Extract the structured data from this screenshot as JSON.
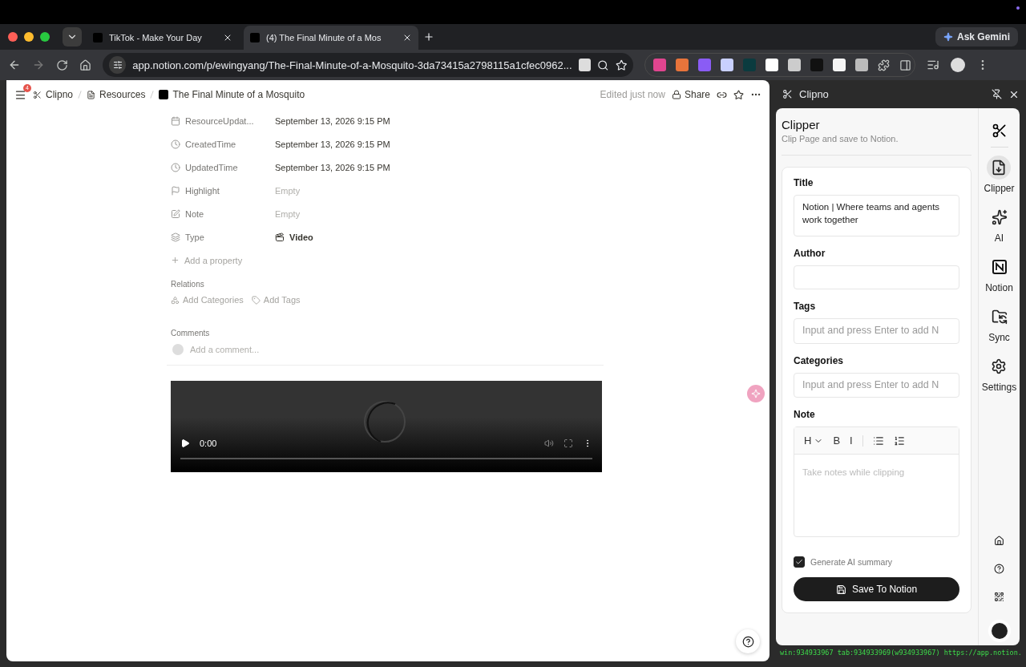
{
  "browser": {
    "tabs": [
      {
        "title": "TikTok - Make Your Day",
        "selected": false
      },
      {
        "title": "(4) The Final Minute of a Mos",
        "selected": true
      }
    ],
    "ask_gemini": "Ask Gemini",
    "url": "app.notion.com/p/ewingyang/The-Final-Minute-of-a-Mosquito-3da73415a2798115a1cfec0962..."
  },
  "notion": {
    "menu_badge": "4",
    "breadcrumb": [
      {
        "label": "Clipno"
      },
      {
        "label": "Resources"
      },
      {
        "label": "The Final Minute of a Mosquito"
      }
    ],
    "edited": "Edited just now",
    "share": "Share",
    "properties": [
      {
        "kind": "calendar",
        "name": "ResourceUpdat...",
        "value": "September 13, 2026 9:15 PM",
        "empty": false
      },
      {
        "kind": "clock",
        "name": "CreatedTime",
        "value": "September 13, 2026 9:15 PM",
        "empty": false
      },
      {
        "kind": "clock",
        "name": "UpdatedTime",
        "value": "September 13, 2026 9:15 PM",
        "empty": false
      },
      {
        "kind": "flag",
        "name": "Highlight",
        "value": "Empty",
        "empty": true
      },
      {
        "kind": "edit",
        "name": "Note",
        "value": "Empty",
        "empty": true
      },
      {
        "kind": "select",
        "name": "Type",
        "value": "Video",
        "empty": false
      }
    ],
    "add_property": "Add a property",
    "relations": {
      "heading": "Relations",
      "actions": [
        {
          "kind": "categories",
          "label": "Add Categories"
        },
        {
          "kind": "tags",
          "label": "Add Tags"
        }
      ]
    },
    "comments": {
      "heading": "Comments",
      "placeholder": "Add a comment..."
    },
    "video": {
      "time": "0:00"
    }
  },
  "panel": {
    "title": "Clipno",
    "heading": "Clipper",
    "subtitle": "Clip Page and save to Notion.",
    "fields": [
      {
        "kind": "textarea",
        "label": "Title",
        "value": "Notion | Where teams and agents work together"
      },
      {
        "kind": "input",
        "label": "Author"
      },
      {
        "kind": "input",
        "label": "Tags",
        "placeholder": "Input and press Enter to add N"
      },
      {
        "kind": "input",
        "label": "Categories",
        "placeholder": "Input and press Enter to add N"
      },
      {
        "kind": "editor",
        "label": "Note",
        "placeholder": "Take notes while clipping",
        "tools": [
          "H",
          "B",
          "I"
        ]
      }
    ],
    "summary": {
      "label": "Generate AI summary",
      "checked": true
    },
    "save": "Save To Notion",
    "nav": [
      {
        "kind": "clipper",
        "label": "Clipper",
        "selected": true
      },
      {
        "kind": "ai",
        "label": "AI",
        "selected": false
      },
      {
        "kind": "notion",
        "label": "Notion",
        "selected": false
      },
      {
        "kind": "sync",
        "label": "Sync",
        "selected": false
      },
      {
        "kind": "settings",
        "label": "Settings",
        "selected": false
      }
    ]
  },
  "status_bar": "win:934933967 tab:934933969(w934933967) https://app.notion."
}
